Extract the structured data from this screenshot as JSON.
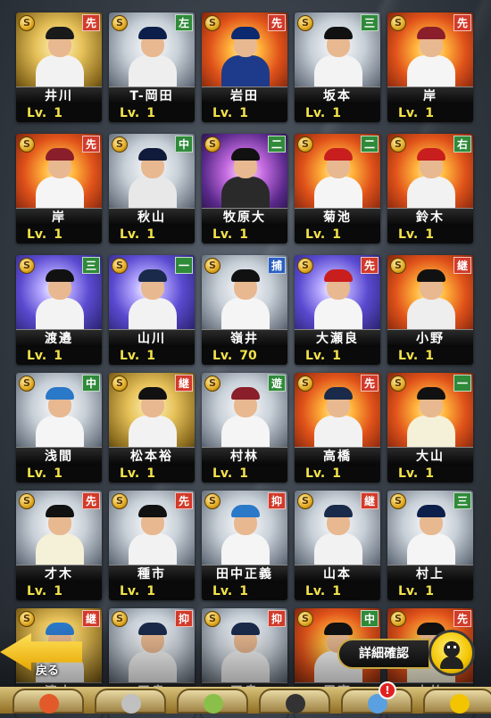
{
  "rows": [
    [
      {
        "name": "井川",
        "pos": "先",
        "posColor": "#d23a2a",
        "level": "1",
        "art": "gold",
        "cap": "#1a1a1a",
        "uni": "#f2f2f2"
      },
      {
        "name": "T-岡田",
        "pos": "左",
        "posColor": "#2f8a3a",
        "level": "1",
        "art": "silver",
        "cap": "#0c1f4a",
        "uni": "#eeeeee"
      },
      {
        "name": "岩田",
        "pos": "先",
        "posColor": "#d23a2a",
        "level": "1",
        "art": "fire",
        "cap": "#0c2a70",
        "uni": "#1d3b8a"
      },
      {
        "name": "坂本",
        "pos": "三",
        "posColor": "#2f8a3a",
        "level": "1",
        "art": "silver",
        "cap": "#111111",
        "uni": "#f3f3f3"
      },
      {
        "name": "岸",
        "pos": "先",
        "posColor": "#d23a2a",
        "level": "1",
        "art": "fire",
        "cap": "#8a1e2a",
        "uni": "#f5f5f5"
      }
    ],
    [
      {
        "name": "岸",
        "pos": "先",
        "posColor": "#d23a2a",
        "level": "1",
        "art": "fire",
        "cap": "#8a1e2a",
        "uni": "#f5f5f5"
      },
      {
        "name": "秋山",
        "pos": "中",
        "posColor": "#2f8a3a",
        "level": "1",
        "art": "silver",
        "cap": "#101a3a",
        "uni": "#e8e8e8"
      },
      {
        "name": "牧原大",
        "pos": "二",
        "posColor": "#2f8a3a",
        "level": "1",
        "art": "purple",
        "cap": "#111111",
        "uni": "#2a2a2a"
      },
      {
        "name": "菊池",
        "pos": "二",
        "posColor": "#2f8a3a",
        "level": "1",
        "art": "fire",
        "cap": "#c81e1e",
        "uni": "#f5f5f5"
      },
      {
        "name": "鈴木",
        "pos": "右",
        "posColor": "#2f8a3a",
        "level": "1",
        "art": "fire",
        "cap": "#c81e1e",
        "uni": "#f2f2f2"
      }
    ],
    [
      {
        "name": "渡邉",
        "pos": "三",
        "posColor": "#2f8a3a",
        "level": "1",
        "art": "galaxy",
        "cap": "#111111",
        "uni": "#f3f3f3"
      },
      {
        "name": "山川",
        "pos": "一",
        "posColor": "#2f8a3a",
        "level": "1",
        "art": "galaxy",
        "cap": "#1a2a4a",
        "uni": "#f2f2f2"
      },
      {
        "name": "嶺井",
        "pos": "捕",
        "posColor": "#2a5fc0",
        "level": "70",
        "art": "silver",
        "cap": "#111111",
        "uni": "#f5f5f5"
      },
      {
        "name": "大瀬良",
        "pos": "先",
        "posColor": "#d23a2a",
        "level": "1",
        "art": "galaxy",
        "cap": "#c81e1e",
        "uni": "#f5f5f5"
      },
      {
        "name": "小野",
        "pos": "継",
        "posColor": "#d23a2a",
        "level": "1",
        "art": "fire",
        "cap": "#111111",
        "uni": "#eeeeee"
      }
    ],
    [
      {
        "name": "浅間",
        "pos": "中",
        "posColor": "#2f8a3a",
        "level": "1",
        "art": "silver",
        "cap": "#2a78c8",
        "uni": "#f5f5f5"
      },
      {
        "name": "松本裕",
        "pos": "継",
        "posColor": "#d23a2a",
        "level": "1",
        "art": "gold",
        "cap": "#111111",
        "uni": "#f2f2f2"
      },
      {
        "name": "村林",
        "pos": "遊",
        "posColor": "#2f8a3a",
        "level": "1",
        "art": "silver",
        "cap": "#8a1e2a",
        "uni": "#f5f5f5"
      },
      {
        "name": "高橋",
        "pos": "先",
        "posColor": "#d23a2a",
        "level": "1",
        "art": "fire",
        "cap": "#1a2a4a",
        "uni": "#f2f2f2"
      },
      {
        "name": "大山",
        "pos": "一",
        "posColor": "#2f8a3a",
        "level": "1",
        "art": "fire",
        "cap": "#111111",
        "uni": "#f5f0d8"
      }
    ],
    [
      {
        "name": "才木",
        "pos": "先",
        "posColor": "#d23a2a",
        "level": "1",
        "art": "silver",
        "cap": "#111111",
        "uni": "#f5f0d8"
      },
      {
        "name": "種市",
        "pos": "先",
        "posColor": "#d23a2a",
        "level": "1",
        "art": "silver",
        "cap": "#111111",
        "uni": "#f2f2f2"
      },
      {
        "name": "田中正義",
        "pos": "抑",
        "posColor": "#d23a2a",
        "level": "1",
        "art": "silver",
        "cap": "#2a78c8",
        "uni": "#f5f5f5"
      },
      {
        "name": "山本",
        "pos": "継",
        "posColor": "#d23a2a",
        "level": "1",
        "art": "silver",
        "cap": "#1a2a4a",
        "uni": "#f2f2f2"
      },
      {
        "name": "村上",
        "pos": "三",
        "posColor": "#2f8a3a",
        "level": "1",
        "art": "silver",
        "cap": "#0c1f4a",
        "uni": "#f5f5f5"
      }
    ],
    [
      {
        "name": "清水",
        "pos": "継",
        "posColor": "#d23a2a",
        "level": "",
        "art": "gold",
        "cap": "#2a78c8",
        "uni": "#f5f5f5"
      },
      {
        "name": "平良",
        "pos": "抑",
        "posColor": "#d23a2a",
        "level": "",
        "art": "silver",
        "cap": "#1a2a4a",
        "uni": "#f2f2f2"
      },
      {
        "name": "平良",
        "pos": "抑",
        "posColor": "#d23a2a",
        "level": "",
        "art": "silver",
        "cap": "#1a2a4a",
        "uni": "#f2f2f2"
      },
      {
        "name": "周東",
        "pos": "中",
        "posColor": "#2f8a3a",
        "level": "",
        "art": "fire",
        "cap": "#111111",
        "uni": "#f5f5f5"
      },
      {
        "name": "大竹",
        "pos": "先",
        "posColor": "#d23a2a",
        "level": "",
        "art": "fire",
        "cap": "#111111",
        "uni": "#f5f0d8"
      }
    ]
  ],
  "coin_symbol": "S",
  "level_prefix": "Lv.",
  "back_label": "戻る",
  "detail_label": "詳細確認",
  "nav_badge": "!",
  "nav_items": [
    {
      "icon": "team-icon",
      "color": "#e25a2a"
    },
    {
      "icon": "trophy-icon",
      "color": "#c0c0c0"
    },
    {
      "icon": "stadium-icon",
      "color": "#8ac04a"
    },
    {
      "icon": "player-icon",
      "color": "#333333"
    },
    {
      "icon": "shop-icon",
      "color": "#5aa0e0"
    },
    {
      "icon": "menu-icon",
      "color": "#f3c400"
    }
  ]
}
